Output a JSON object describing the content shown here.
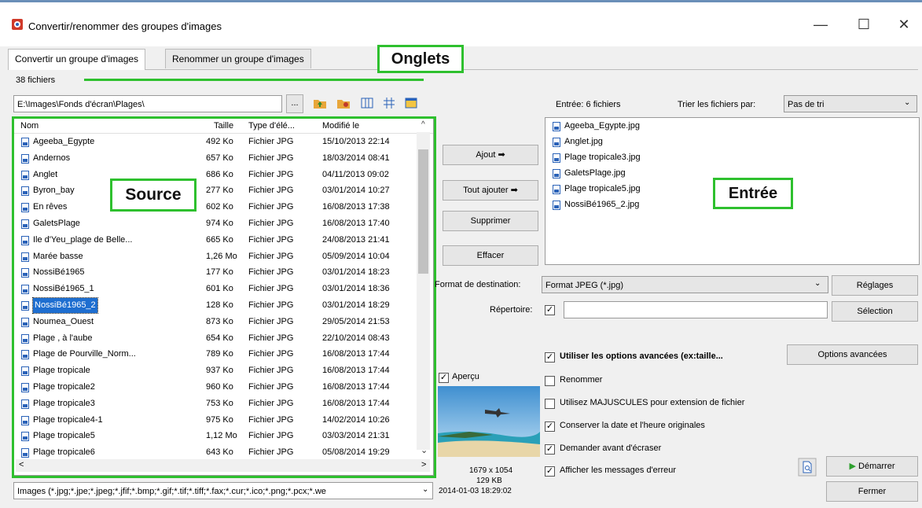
{
  "window": {
    "title": "Convertir/renommer des groupes d'images",
    "minimize": "—",
    "maximize": "☐",
    "close": "✕"
  },
  "tabs": [
    {
      "label": "Convertir un groupe d'images"
    },
    {
      "label": "Renommer un groupe d'images"
    }
  ],
  "callouts": {
    "tabs": "Onglets",
    "source": "Source",
    "entry": "Entrée"
  },
  "file_count": "38 fichiers",
  "path": {
    "value": "E:\\Images\\Fonds d'écran\\Plages\\",
    "browse": "..."
  },
  "columns": [
    "Nom",
    "Taille",
    "Type d'élé...",
    "Modifié le"
  ],
  "files": [
    {
      "name": "Ageeba_Egypte",
      "size": "492 Ko",
      "type": "Fichier JPG",
      "date": "15/10/2013 22:14"
    },
    {
      "name": "Andernos",
      "size": "657 Ko",
      "type": "Fichier JPG",
      "date": "18/03/2014 08:41"
    },
    {
      "name": "Anglet",
      "size": "686 Ko",
      "type": "Fichier JPG",
      "date": "04/11/2013 09:02"
    },
    {
      "name": "Byron_bay",
      "size": "277 Ko",
      "type": "Fichier JPG",
      "date": "03/01/2014 10:27"
    },
    {
      "name": "En rêves",
      "size": "602 Ko",
      "type": "Fichier JPG",
      "date": "16/08/2013 17:38"
    },
    {
      "name": "GaletsPlage",
      "size": "974 Ko",
      "type": "Fichier JPG",
      "date": "16/08/2013 17:40"
    },
    {
      "name": "Ile d'Yeu_plage de Belle...",
      "size": "665 Ko",
      "type": "Fichier JPG",
      "date": "24/08/2013 21:41"
    },
    {
      "name": "Marée basse",
      "size": "1,26 Mo",
      "type": "Fichier JPG",
      "date": "05/09/2014 10:04"
    },
    {
      "name": "NossiBé1965",
      "size": "177 Ko",
      "type": "Fichier JPG",
      "date": "03/01/2014 18:23"
    },
    {
      "name": "NossiBé1965_1",
      "size": "601 Ko",
      "type": "Fichier JPG",
      "date": "03/01/2014 18:36"
    },
    {
      "name": "NossiBé1965_2",
      "size": "128 Ko",
      "type": "Fichier JPG",
      "date": "03/01/2014 18:29"
    },
    {
      "name": "Noumea_Ouest",
      "size": "873 Ko",
      "type": "Fichier JPG",
      "date": "29/05/2014 21:53"
    },
    {
      "name": "Plage , à l'aube",
      "size": "654 Ko",
      "type": "Fichier JPG",
      "date": "22/10/2014 08:43"
    },
    {
      "name": "Plage de Pourville_Norm...",
      "size": "789 Ko",
      "type": "Fichier JPG",
      "date": "16/08/2013 17:44"
    },
    {
      "name": "Plage tropicale",
      "size": "937 Ko",
      "type": "Fichier JPG",
      "date": "16/08/2013 17:44"
    },
    {
      "name": "Plage tropicale2",
      "size": "960 Ko",
      "type": "Fichier JPG",
      "date": "16/08/2013 17:44"
    },
    {
      "name": "Plage tropicale3",
      "size": "753 Ko",
      "type": "Fichier JPG",
      "date": "16/08/2013 17:44"
    },
    {
      "name": "Plage tropicale4-1",
      "size": "975 Ko",
      "type": "Fichier JPG",
      "date": "14/02/2014 10:26"
    },
    {
      "name": "Plage tropicale5",
      "size": "1,12 Mo",
      "type": "Fichier JPG",
      "date": "03/03/2014 21:31"
    },
    {
      "name": "Plage tropicale6",
      "size": "643 Ko",
      "type": "Fichier JPG",
      "date": "05/08/2014 19:29"
    }
  ],
  "filter": "Images (*.jpg;*.jpe;*.jpeg;*.jfif;*.bmp;*.gif;*.tif;*.tiff;*.fax;*.cur;*.ico;*.png;*.pcx;*.we",
  "buttons": {
    "add": "Ajout ➡",
    "add_all": "Tout ajouter ➡",
    "remove": "Supprimer",
    "clear": "Effacer",
    "settings": "Réglages",
    "select": "Sélection",
    "advanced": "Options avancées",
    "start": "Démarrer",
    "close": "Fermer"
  },
  "entry": {
    "label": "Entrée: 6 fichiers",
    "sort_label": "Trier les fichiers par:",
    "sort_value": "Pas de tri",
    "files": [
      "Ageeba_Egypte.jpg",
      "Anglet.jpg",
      "Plage tropicale3.jpg",
      "GaletsPlage.jpg",
      "Plage tropicale5.jpg",
      "NossiBé1965_2.jpg"
    ]
  },
  "format": {
    "label": "Format de destination:",
    "value": "Format JPEG (*.jpg)"
  },
  "directory": {
    "label": "Répertoire:",
    "value": ""
  },
  "preview": {
    "label": "Aperçu",
    "dimensions": "1679 x 1054",
    "size": "129 KB",
    "date": "2014-01-03 18:29:02"
  },
  "options": {
    "advanced": "Utiliser les options avancées (ex:taille...",
    "rename": "Renommer",
    "uppercase": "Utilisez MAJUSCULES pour extension de fichier",
    "keep_date": "Conserver la date et l'heure originales",
    "ask_overwrite": "Demander avant d'écraser",
    "show_errors": "Afficher les messages d'erreur"
  }
}
